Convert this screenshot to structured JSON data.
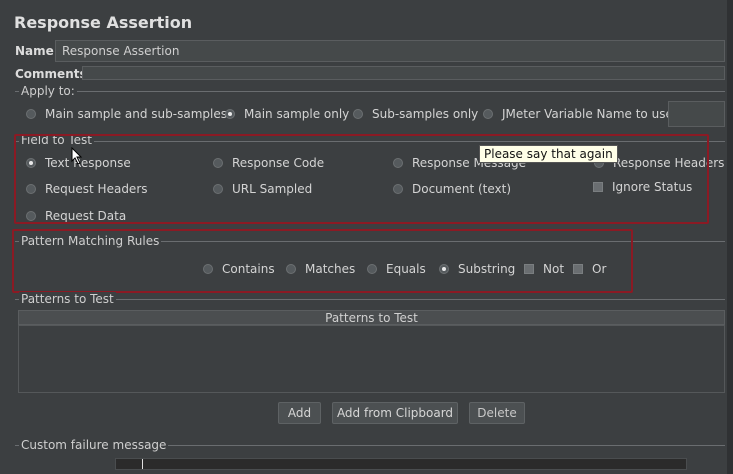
{
  "window": {
    "title": "Response Assertion"
  },
  "name_field": {
    "label": "Name:",
    "value": "Response Assertion"
  },
  "comments": {
    "label": "Comments:"
  },
  "apply_to": {
    "legend": "Apply to:",
    "options": [
      {
        "label": "Main sample and sub-samples",
        "selected": false
      },
      {
        "label": "Main sample only",
        "selected": true
      },
      {
        "label": "Sub-samples only",
        "selected": false
      },
      {
        "label": "JMeter Variable Name to use",
        "selected": false
      }
    ]
  },
  "field_to_test": {
    "legend": "Field to Test",
    "options": {
      "text_response": {
        "label": "Text Response",
        "selected": true
      },
      "response_code": {
        "label": "Response Code",
        "selected": false
      },
      "response_message": {
        "label": "Response Message",
        "selected": false
      },
      "response_headers": {
        "label": "Response Headers",
        "selected": false
      },
      "request_headers": {
        "label": "Request Headers",
        "selected": false
      },
      "url_sampled": {
        "label": "URL Sampled",
        "selected": false
      },
      "document_text": {
        "label": "Document (text)",
        "selected": false
      },
      "ignore_status": {
        "label": "Ignore Status",
        "checked": false
      },
      "request_data": {
        "label": "Request Data",
        "selected": false
      }
    }
  },
  "tooltip": {
    "text": "Please say that again"
  },
  "pattern_matching": {
    "legend": "Pattern Matching Rules",
    "options": {
      "contains": {
        "label": "Contains",
        "selected": false
      },
      "matches": {
        "label": "Matches",
        "selected": false
      },
      "equals": {
        "label": "Equals",
        "selected": false
      },
      "substring": {
        "label": "Substring",
        "selected": true
      },
      "not": {
        "label": "Not",
        "checked": false
      },
      "or": {
        "label": "Or",
        "checked": false
      }
    }
  },
  "patterns_to_test": {
    "legend": "Patterns to Test",
    "column_header": "Patterns to Test",
    "buttons": {
      "add": "Add",
      "add_from_clipboard": "Add from Clipboard",
      "delete": "Delete"
    }
  },
  "custom_failure": {
    "legend": "Custom failure message"
  },
  "colors": {
    "highlight_border": "#8b1a24",
    "background": "#3c3f41"
  }
}
